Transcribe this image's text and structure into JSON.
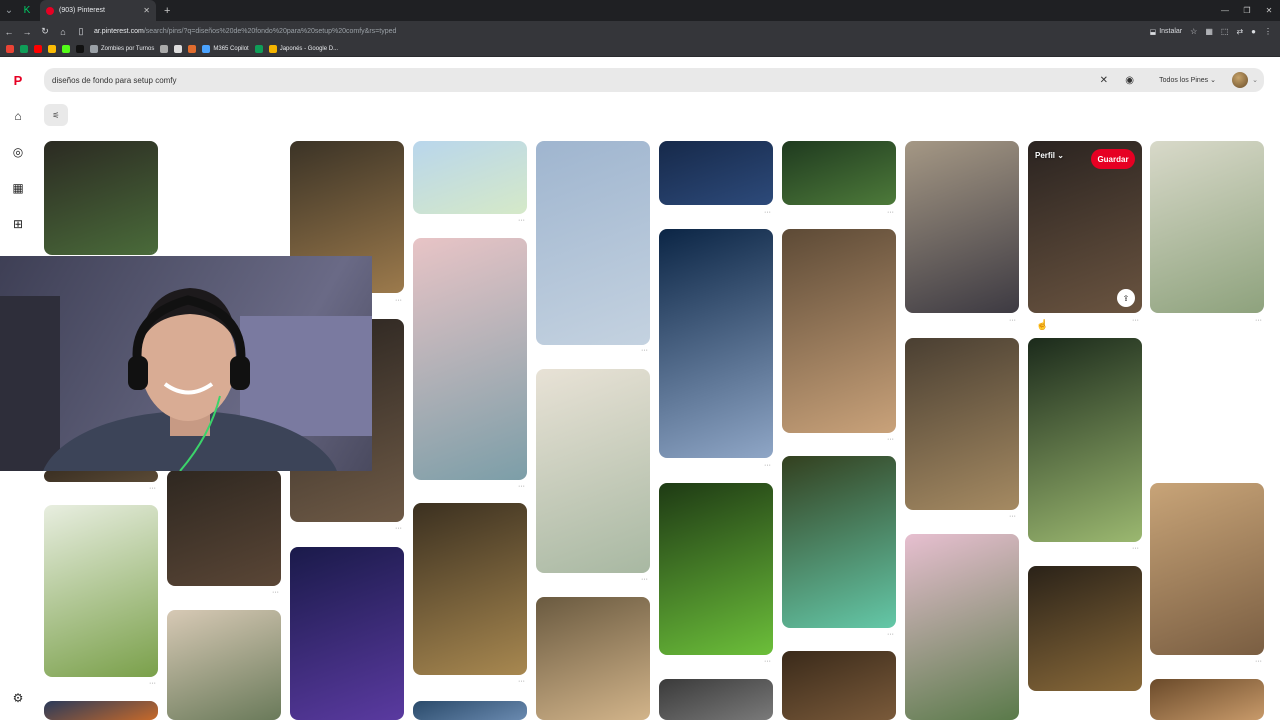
{
  "browser": {
    "tab_title": "(903) Pinterest",
    "url_host": "ar.pinterest.com",
    "url_path": "/search/pins/?q=diseños%20de%20fondo%20para%20setup%20comfy&rs=typed",
    "install_label": "Instalar",
    "bookmarks": [
      {
        "label": "Zombies por Turnos",
        "color": "#9aa0a6"
      },
      {
        "label": "M365 Copilot",
        "color": "#4aa3ff"
      },
      {
        "label": "Japonés - Google D...",
        "color": "#f4b400"
      }
    ]
  },
  "search": {
    "query": "diseños de fondo para setup comfy",
    "filter_label": "Todos los Pines"
  },
  "hover": {
    "profile_label": "Perfil",
    "save_label": "Guardar"
  },
  "icons": {
    "pinterest": "pinterest-logo-icon",
    "home": "home-icon",
    "explore": "compass-icon",
    "boards": "board-icon",
    "create": "plus-icon",
    "settings": "gear-icon",
    "filters": "filters-icon",
    "clear": "close-icon",
    "camera": "camera-search-icon",
    "share": "share-icon"
  },
  "colors": {
    "brand": "#e60023",
    "search_bg": "#e9e9e9"
  }
}
